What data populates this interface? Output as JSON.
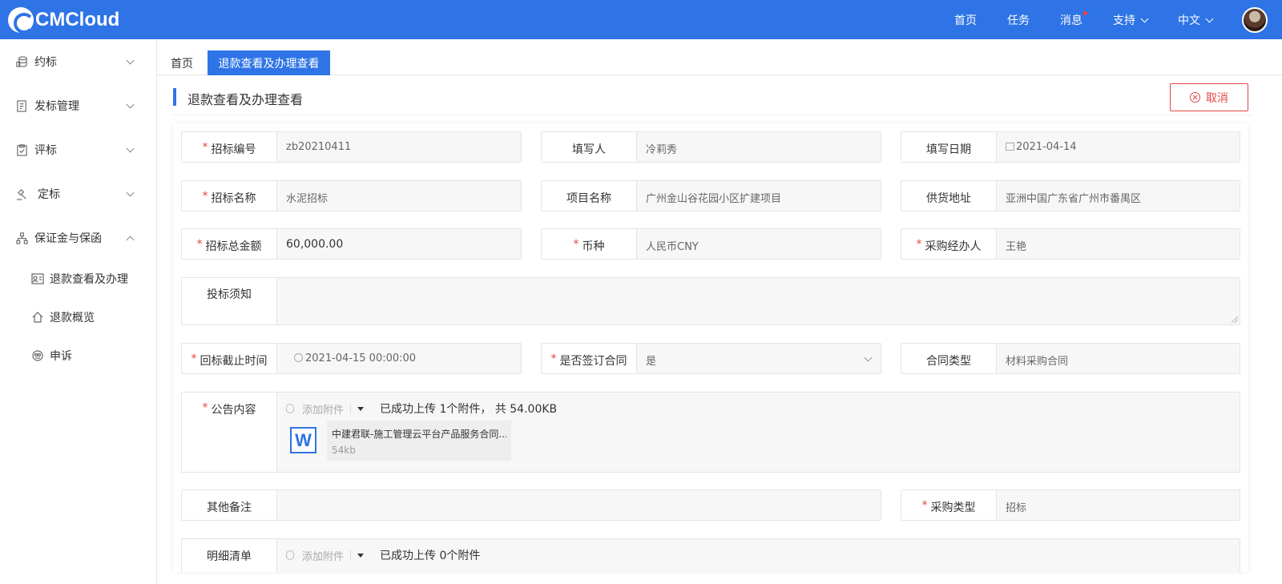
{
  "header": {
    "brand": "CMCloud",
    "nav": [
      {
        "label": "首页"
      },
      {
        "label": "任务"
      },
      {
        "label": "消息"
      },
      {
        "label": "支持"
      },
      {
        "label": "中文"
      }
    ]
  },
  "sidebar": {
    "items": [
      {
        "label": "约标"
      },
      {
        "label": "发标管理"
      },
      {
        "label": "评标"
      },
      {
        "label": "定标"
      },
      {
        "label": "保证金与保函"
      }
    ],
    "subitems": [
      {
        "label": "退款查看及办理"
      },
      {
        "label": "退款概览"
      },
      {
        "label": "申诉"
      }
    ]
  },
  "tabs": {
    "home": "首页",
    "active": "退款查看及办理查看"
  },
  "page": {
    "title": "退款查看及办理查看",
    "cancel_label": "取消"
  },
  "form": {
    "bid_no": {
      "label": "招标编号",
      "value": "zb20210411"
    },
    "filler": {
      "label": "填写人",
      "value": "冷莉秀"
    },
    "fill_date": {
      "label": "填写日期",
      "value": "2021-04-14"
    },
    "bid_name": {
      "label": "招标名称",
      "value": "水泥招标"
    },
    "project_name": {
      "label": "项目名称",
      "value": "广州金山谷花园小区扩建项目"
    },
    "supply_address": {
      "label": "供货地址",
      "value": "亚洲中国广东省广州市番禺区"
    },
    "total_amount": {
      "label": "招标总金额",
      "value": "60,000.00"
    },
    "currency": {
      "label": "币种",
      "value": "人民币CNY"
    },
    "purchaser": {
      "label": "采购经办人",
      "value": "王艳"
    },
    "bid_notice": {
      "label": "投标须知",
      "value": ""
    },
    "deadline": {
      "label": "回标截止时间",
      "value": "2021-04-15 00:00:00"
    },
    "sign_contract": {
      "label": "是否签订合同",
      "value": "是"
    },
    "contract_type": {
      "label": "合同类型",
      "value": "材料采购合同"
    },
    "announcement": {
      "label": "公告内容",
      "add_label": "添加附件",
      "status": "已成功上传 1个附件， 共 54.00KB",
      "file_name": "中建君联-施工管理云平台产品服务合同...",
      "file_size": "54kb"
    },
    "other_notes": {
      "label": "其他备注",
      "value": ""
    },
    "purchase_type": {
      "label": "采购类型",
      "value": "招标"
    },
    "detail_list": {
      "label": "明细清单",
      "add_label": "添加附件",
      "status": "已成功上传 0个附件"
    }
  },
  "colors": {
    "primary": "#2e74e6",
    "danger": "#e64545",
    "required": "#e64545"
  }
}
